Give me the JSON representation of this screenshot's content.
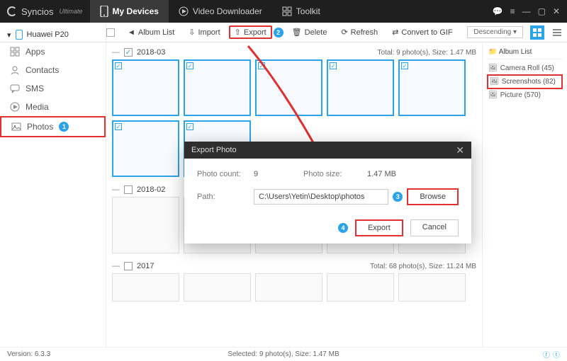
{
  "app": {
    "name": "Syncios",
    "edition": "Ultimate"
  },
  "topTabs": {
    "devices": "My Devices",
    "downloader": "Video Downloader",
    "toolkit": "Toolkit"
  },
  "device": {
    "name": "Huawei P20"
  },
  "sidebar": {
    "items": [
      {
        "label": "Apps"
      },
      {
        "label": "Contacts"
      },
      {
        "label": "SMS"
      },
      {
        "label": "Media"
      },
      {
        "label": "Photos"
      }
    ]
  },
  "toolbar": {
    "albumList": "Album List",
    "import": "Import",
    "export": "Export",
    "delete": "Delete",
    "refresh": "Refresh",
    "convert": "Convert to GIF",
    "sort": "Descending"
  },
  "sections": {
    "s1": {
      "name": "2018-03",
      "summary": "Total: 9 photo(s), Size: 1.47 MB"
    },
    "s2": {
      "name": "2018-02"
    },
    "s3": {
      "name": "2017",
      "summary": "Total: 68 photo(s), Size: 11.24 MB"
    }
  },
  "albums": {
    "header": "Album List",
    "rows": {
      "camera": "Camera Roll (45)",
      "screens": "Screenshots (82)",
      "picture": "Picture (570)"
    }
  },
  "modal": {
    "title": "Export Photo",
    "countLabel": "Photo count:",
    "countValue": "9",
    "sizeLabel": "Photo size:",
    "sizeValue": "1.47 MB",
    "pathLabel": "Path:",
    "pathValue": "C:\\Users\\Yetin\\Desktop\\photos",
    "browse": "Browse",
    "export": "Export",
    "cancel": "Cancel"
  },
  "footer": {
    "version": "Version: 6.3.3",
    "selection": "Selected: 9 photo(s), Size: 1.47 MB"
  },
  "badges": {
    "one": "1",
    "two": "2",
    "three": "3",
    "four": "4"
  }
}
